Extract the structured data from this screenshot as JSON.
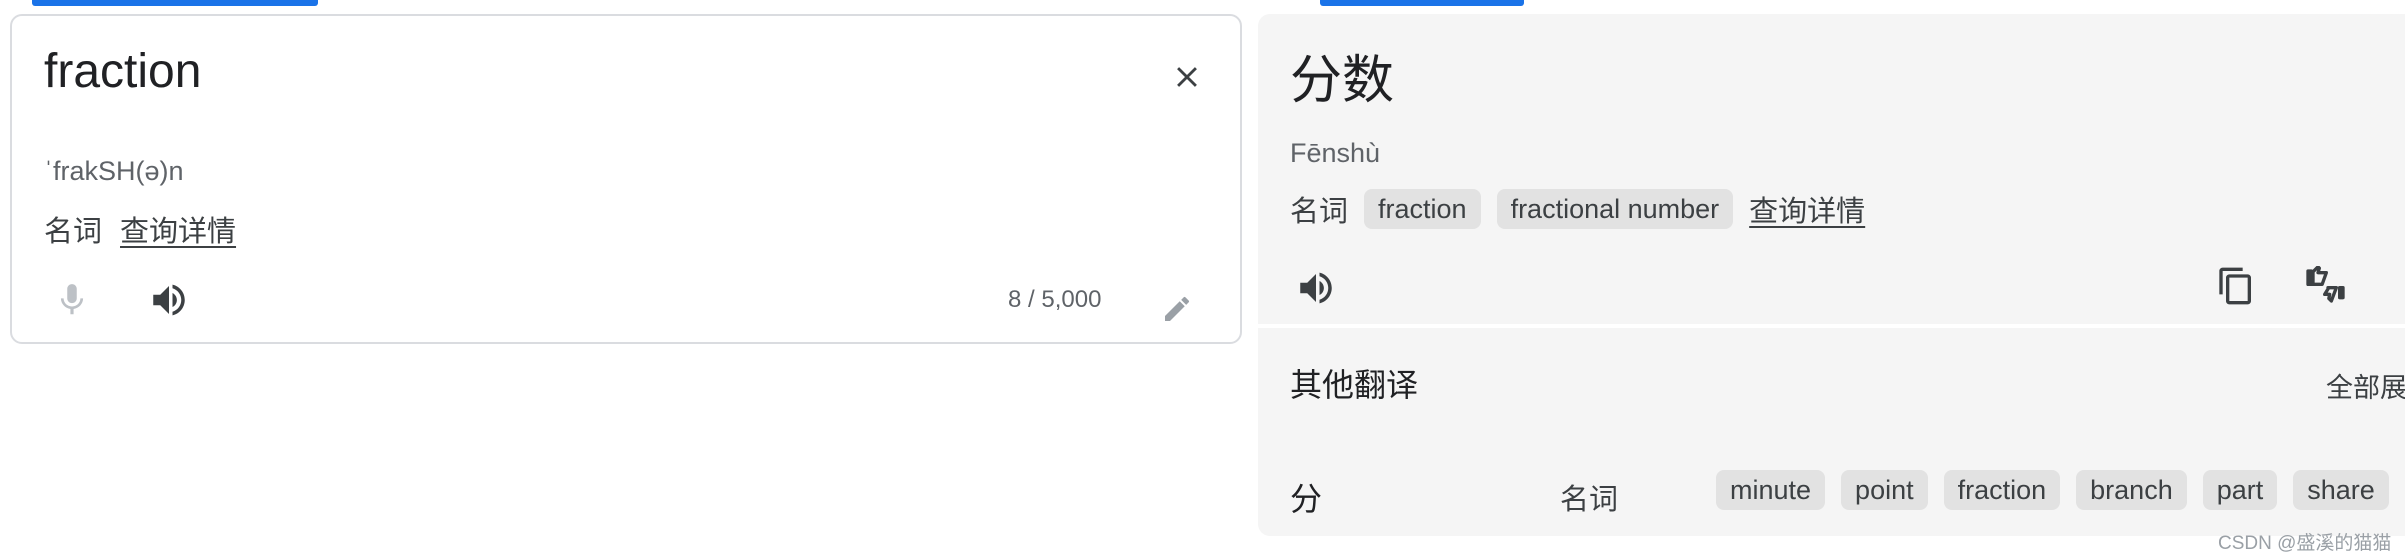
{
  "source": {
    "text": "fraction",
    "phonetic": "ˈfrakSH(ə)n",
    "pos": "名词",
    "details_link": "查询详情",
    "char_count": "8 / 5,000"
  },
  "target": {
    "text": "分数",
    "romanization": "Fēnshù",
    "pos": "名词",
    "chips": [
      "fraction",
      "fractional number"
    ],
    "details_link": "查询详情"
  },
  "other_translations": {
    "heading": "其他翻译",
    "expand_all": "全部展",
    "rows": [
      {
        "word": "分",
        "pos": "名词",
        "translations": [
          "minute",
          "point",
          "fraction",
          "branch",
          "part",
          "share"
        ]
      }
    ]
  },
  "watermark": "CSDN @盛溪的猫猫",
  "icons": {
    "clear": "close-icon",
    "mic": "microphone-icon",
    "speaker": "speaker-icon",
    "edit": "pencil-icon",
    "copy": "copy-icon",
    "rate": "thumbs-up-down-icon"
  },
  "colors": {
    "accent": "#1a73e8",
    "panel_bg": "#f5f5f5",
    "chip_bg": "#e2e2e2",
    "border": "#dadce0"
  }
}
